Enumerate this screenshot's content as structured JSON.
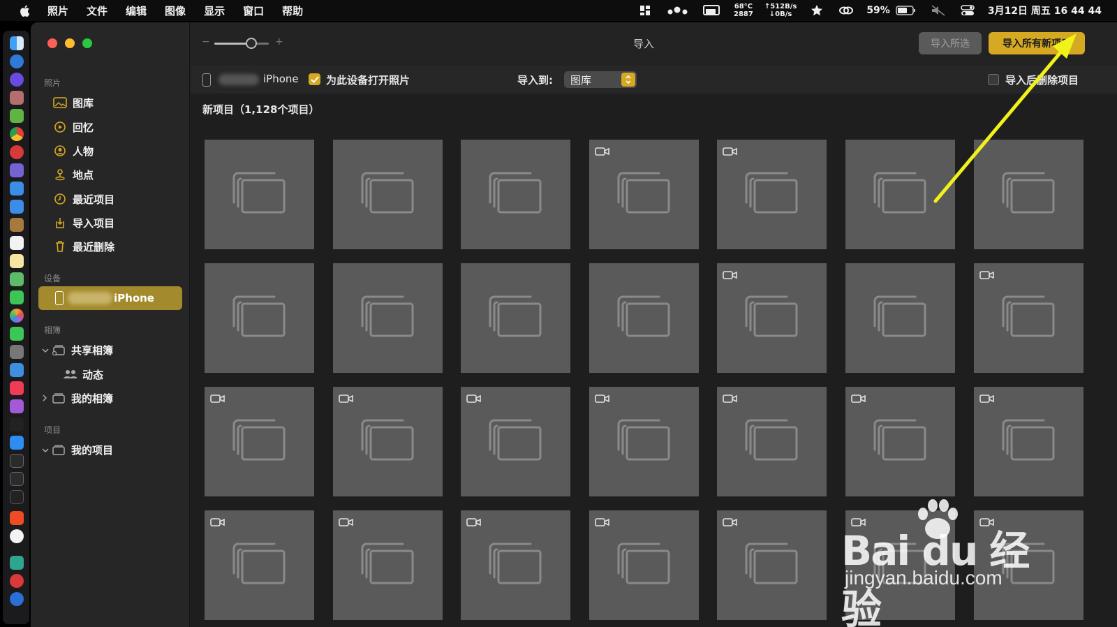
{
  "menubar": {
    "app_menus": [
      "照片",
      "文件",
      "编辑",
      "图像",
      "显示",
      "窗口",
      "帮助"
    ],
    "temp": "68°C",
    "fan": "2887",
    "net_up": "↑512B/s",
    "net_down": "↓0B/s",
    "battery": "59%",
    "datetime": "3月12日 周五  16 44 44"
  },
  "sidebar": {
    "sections": {
      "photos": "照片",
      "devices": "设备",
      "albums": "相簿",
      "projects": "项目"
    },
    "photos_items": [
      {
        "label": "图库",
        "icon": "library-icon"
      },
      {
        "label": "回忆",
        "icon": "memories-icon"
      },
      {
        "label": "人物",
        "icon": "people-icon"
      },
      {
        "label": "地点",
        "icon": "places-icon"
      },
      {
        "label": "最近项目",
        "icon": "recent-icon"
      },
      {
        "label": "导入项目",
        "icon": "imports-icon"
      },
      {
        "label": "最近删除",
        "icon": "trash-icon"
      }
    ],
    "device_label": "iPhone",
    "albums_items": {
      "shared": "共享相簿",
      "activity": "动态",
      "my_albums": "我的相簿"
    },
    "projects_items": {
      "my_projects": "我的项目"
    }
  },
  "toolbar": {
    "title": "导入",
    "import_selected": "导入所选",
    "import_all": "导入所有新项目",
    "slider_value": 0.65
  },
  "options": {
    "device_name": "iPhone",
    "open_photos_label": "为此设备打开照片",
    "open_photos_checked": true,
    "import_to_label": "导入到:",
    "import_to_value": "图库",
    "delete_after_label": "导入后删除项目",
    "delete_after_checked": false
  },
  "content": {
    "heading": "新项目（1,128个项目）",
    "rows": [
      [
        false,
        false,
        false,
        true,
        true,
        false,
        false
      ],
      [
        false,
        false,
        false,
        false,
        true,
        false,
        true
      ],
      [
        true,
        true,
        true,
        true,
        true,
        true,
        true
      ],
      [
        true,
        true,
        true,
        true,
        true,
        true,
        true
      ]
    ]
  },
  "watermark": {
    "logo": "Bai du 经验",
    "url": "jingyan.baidu.com"
  },
  "colors": {
    "accent": "#d6a923",
    "device_selected": "#a38a2c",
    "tile": "#5a5a5a",
    "arrow": "#f2f21b"
  }
}
